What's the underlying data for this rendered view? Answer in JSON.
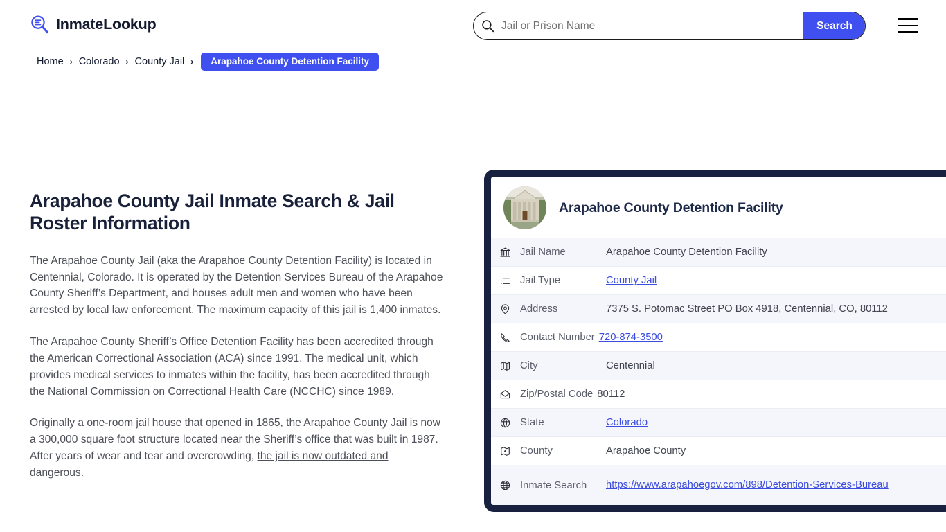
{
  "header": {
    "logo_text": "InmateLookup",
    "logo_icon": "magnifier-list-icon",
    "search": {
      "placeholder": "Jail or Prison Name",
      "value": "",
      "button_label": "Search",
      "icon": "search-icon"
    },
    "menu_icon": "hamburger-menu-icon"
  },
  "breadcrumb": {
    "items": [
      {
        "label": "Home"
      },
      {
        "label": "Colorado"
      },
      {
        "label": "County Jail"
      }
    ],
    "separator": "›",
    "current": "Arapahoe County Detention Facility"
  },
  "article": {
    "title": "Arapahoe County Jail Inmate Search & Jail Roster Information",
    "paragraphs": [
      "The Arapahoe County Jail (aka the Arapahoe County Detention Facility) is located in Centennial, Colorado. It is operated by the Detention Services Bureau of the Arapahoe County Sheriff’s Department, and houses adult men and women who have been arrested by local law enforcement. The maximum capacity of this jail is 1,400 inmates.",
      "The Arapahoe County Sheriff’s Office Detention Facility has been accredited through the American Correctional Association (ACA) since 1991. The medical unit, which provides medical services to inmates within the facility, has been accredited through the National Commission on Correctional Health Care (NCCHC) since 1989."
    ],
    "paragraph3_before": "Originally a one-room jail house that opened in 1865, the Arapahoe County Jail is now a 300,000 square foot structure located near the Sheriff’s office that was built in 1987. After years of wear and tear and overcrowding, ",
    "paragraph3_link": "the jail is now outdated and dangerous",
    "paragraph3_after": "."
  },
  "info_card": {
    "title": "Arapahoe County Detention Facility",
    "thumbnail_icon": "courthouse-building-photo",
    "rows": [
      {
        "icon": "bank-building-icon",
        "label": "Jail Name",
        "value": "Arapahoe County Detention Facility",
        "is_link": false
      },
      {
        "icon": "list-icon",
        "label": "Jail Type",
        "value": "County Jail",
        "is_link": true
      },
      {
        "icon": "location-pin-icon",
        "label": "Address",
        "value": "7375 S. Potomac Street PO Box 4918, Centennial, CO, 80112",
        "is_link": false
      },
      {
        "icon": "phone-icon",
        "label": "Contact Number",
        "value": "720-874-3500",
        "is_link": true
      },
      {
        "icon": "map-icon",
        "label": "City",
        "value": "Centennial",
        "is_link": false
      },
      {
        "icon": "envelope-icon",
        "label": "Zip/Postal Code",
        "value": "80112",
        "is_link": false
      },
      {
        "icon": "compass-globe-icon",
        "label": "State",
        "value": "Colorado",
        "is_link": true
      },
      {
        "icon": "map-pin-area-icon",
        "label": "County",
        "value": "Arapahoe County",
        "is_link": false
      },
      {
        "icon": "globe-icon",
        "label": "Inmate Search",
        "value": "https://www.arapahoegov.com/898/Detention-Services-Bureau",
        "is_link": true
      }
    ]
  },
  "colors": {
    "accent_blue": "#4050f0",
    "link_blue": "#3b4ce0",
    "card_border_navy": "#18213f",
    "row_shade": "#f5f6fb",
    "title_navy": "#19203a",
    "body_text": "#4c4f57"
  }
}
